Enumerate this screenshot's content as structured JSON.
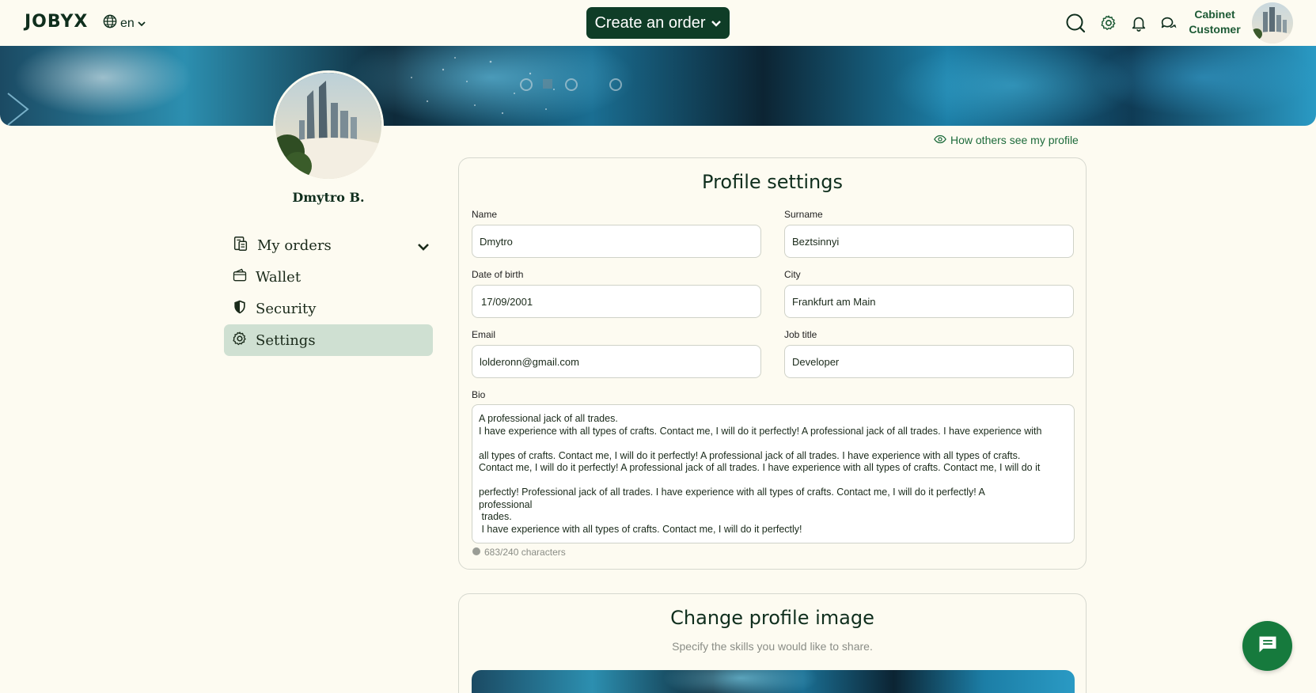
{
  "header": {
    "logo": "JOBYX",
    "language": "en",
    "create_order_label": "Create an order",
    "cabinet_line1": "Cabinet",
    "cabinet_line2": "Customer"
  },
  "profile": {
    "display_name": "Dmytro B."
  },
  "sidebar": {
    "items": [
      {
        "label": "My orders",
        "icon": "orders-icon",
        "expandable": true
      },
      {
        "label": "Wallet",
        "icon": "wallet-icon"
      },
      {
        "label": "Security",
        "icon": "shield-icon"
      },
      {
        "label": "Settings",
        "icon": "gear-icon",
        "active": true
      }
    ]
  },
  "how_others_link": "How others see my profile",
  "settings_card": {
    "title": "Profile settings",
    "fields": {
      "name": {
        "label": "Name",
        "value": "Dmytro"
      },
      "surname": {
        "label": "Surname",
        "value": "Beztsinnyi"
      },
      "dob": {
        "label": "Date of birth",
        "value": "17/09/2001"
      },
      "city": {
        "label": "City",
        "value": "Frankfurt am Main"
      },
      "email": {
        "label": "Email",
        "value": "lolderonn@gmail.com"
      },
      "job_title": {
        "label": "Job title",
        "value": "Developer"
      }
    },
    "bio_label": "Bio",
    "bio_value": "A professional jack of all trades.\nI have experience with all types of crafts. Contact me, I will do it perfectly! A professional jack of all trades. I have experience with\n\nall types of crafts. Contact me, I will do it perfectly! A professional jack of all trades. I have experience with all types of crafts.\nContact me, I will do it perfectly! A professional jack of all trades. I have experience with all types of crafts. Contact me, I will do it\n\nperfectly! Professional jack of all trades. I have experience with all types of crafts. Contact me, I will do it perfectly! A\nprofessional\n trades.\n I have experience with all types of crafts. Contact me, I will do it perfectly!",
    "char_count": "683/240 characters"
  },
  "image_card": {
    "title": "Change profile image",
    "subtitle": "Specify the skills you would like to share."
  },
  "colors": {
    "background": "#fdfbf1",
    "primary_dark": "#0f3d27",
    "accent_green": "#167a3d",
    "active_item": "#cfe0d2"
  }
}
